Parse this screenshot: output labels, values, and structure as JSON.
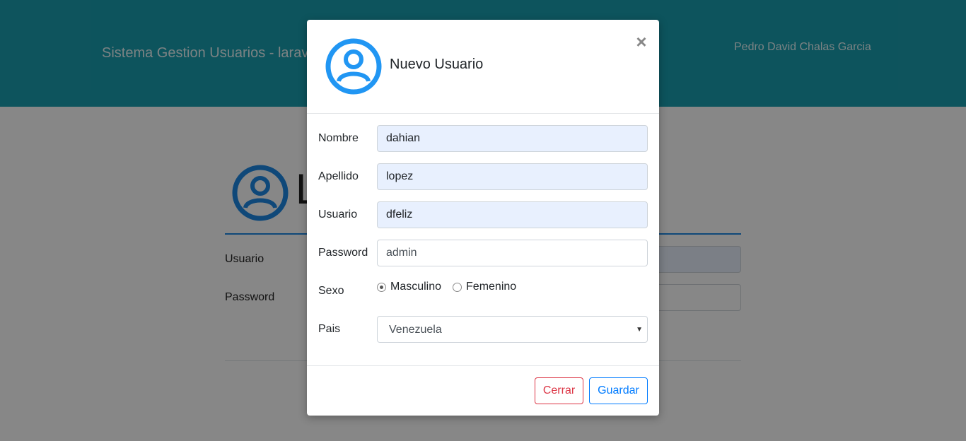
{
  "navbar": {
    "brand": "Sistema Gestion Usuarios - larave",
    "user": "Pedro David Chalas Garcia",
    "color": "#1a9fb0"
  },
  "background_login": {
    "title_visible": "L",
    "usuario_label": "Usuario",
    "password_label": "Password",
    "icon": "user-circle-icon"
  },
  "modal": {
    "title": "Nuevo Usuario",
    "icon": "user-circle-icon",
    "close": "×",
    "fields": {
      "nombre": {
        "label": "Nombre",
        "value": "dahian"
      },
      "apellido": {
        "label": "Apellido",
        "value": "lopez"
      },
      "usuario": {
        "label": "Usuario",
        "value": "dfeliz"
      },
      "password": {
        "label": "Password",
        "value": "admin"
      },
      "sexo": {
        "label": "Sexo",
        "options": [
          "Masculino",
          "Femenino"
        ],
        "selected": "Masculino"
      },
      "pais": {
        "label": "Pais",
        "value": "Venezuela"
      }
    },
    "buttons": {
      "cerrar": "Cerrar",
      "guardar": "Guardar"
    },
    "colors": {
      "icon": "#2196f3",
      "cerrar": "#dc3545",
      "guardar": "#007bff"
    }
  }
}
